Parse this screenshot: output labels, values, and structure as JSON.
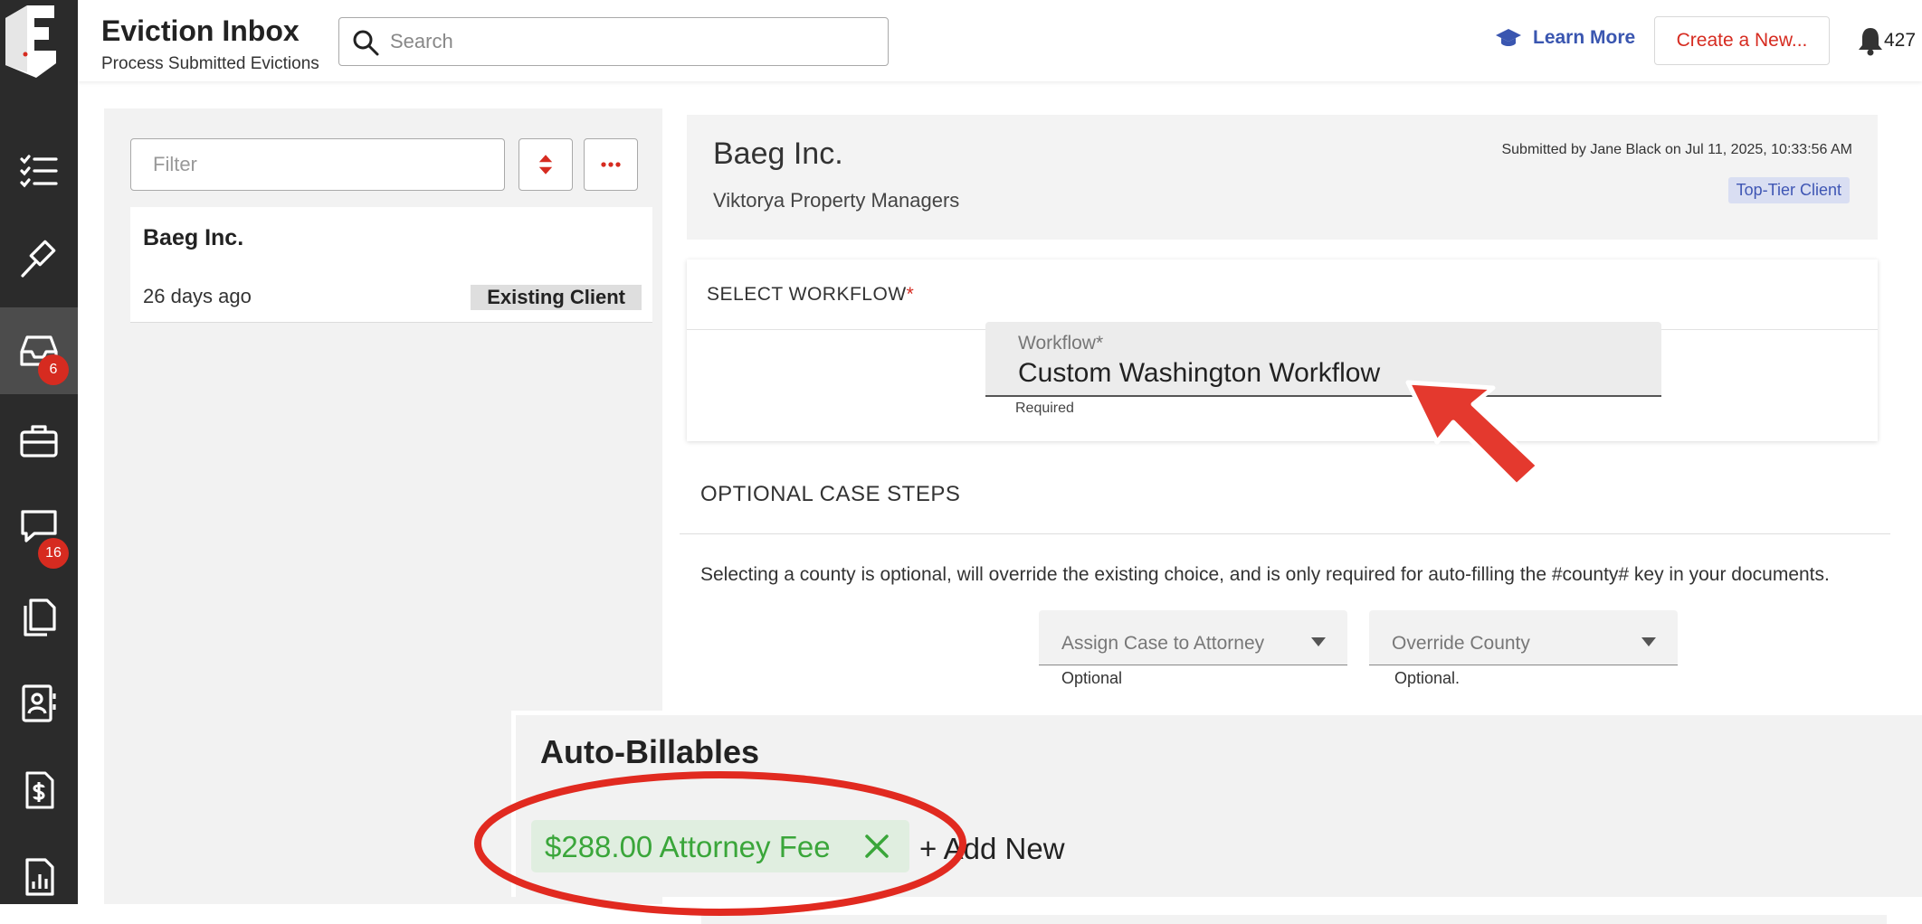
{
  "app": {
    "title": "Eviction Inbox",
    "subtitle": "Process Submitted Evictions"
  },
  "search": {
    "placeholder": "Search"
  },
  "header": {
    "learn_more": "Learn More",
    "create_new": "Create a New...",
    "notification_count": "427"
  },
  "rail": {
    "items": [
      {
        "icon": "checklist-icon",
        "badge": ""
      },
      {
        "icon": "gavel-icon",
        "badge": ""
      },
      {
        "icon": "inbox-icon",
        "badge": "6",
        "active": true
      },
      {
        "icon": "briefcase-icon",
        "badge": ""
      },
      {
        "icon": "chat-icon",
        "badge": "16"
      },
      {
        "icon": "documents-icon",
        "badge": ""
      },
      {
        "icon": "contact-card-icon",
        "badge": ""
      },
      {
        "icon": "invoice-icon",
        "badge": ""
      },
      {
        "icon": "report-icon",
        "badge": ""
      }
    ]
  },
  "list": {
    "filter_placeholder": "Filter",
    "items": [
      {
        "title": "Baeg Inc.",
        "age": "26 days ago",
        "tag": "Existing Client"
      }
    ]
  },
  "detail": {
    "client_name": "Baeg Inc.",
    "client_sub": "Viktorya Property Managers",
    "submitted": "Submitted by Jane Black on Jul 11, 2025, 10:33:56 AM",
    "tier": "Top-Tier Client"
  },
  "workflow": {
    "section_label": "SELECT WORKFLOW",
    "required_mark": "*",
    "field_label": "Workflow*",
    "field_value": "Custom Washington Workflow",
    "helper": "Required"
  },
  "optional_steps": {
    "title": "OPTIONAL CASE STEPS",
    "description": "Selecting a county is optional, will override the existing choice, and is only required for auto-filling the #county# key in your documents.",
    "attorney": {
      "placeholder": "Assign Case to Attorney",
      "helper": "Optional"
    },
    "county": {
      "placeholder": "Override County",
      "helper": "Optional."
    }
  },
  "billables": {
    "title": "Auto-Billables",
    "items": [
      {
        "label": "$288.00 Attorney Fee"
      }
    ],
    "add_new": "+ Add New"
  },
  "colors": {
    "rail_bg": "#2b2b2b",
    "accent_red": "#d62b20",
    "link_blue": "#3a56b0",
    "fee_green": "#3aa63a"
  }
}
